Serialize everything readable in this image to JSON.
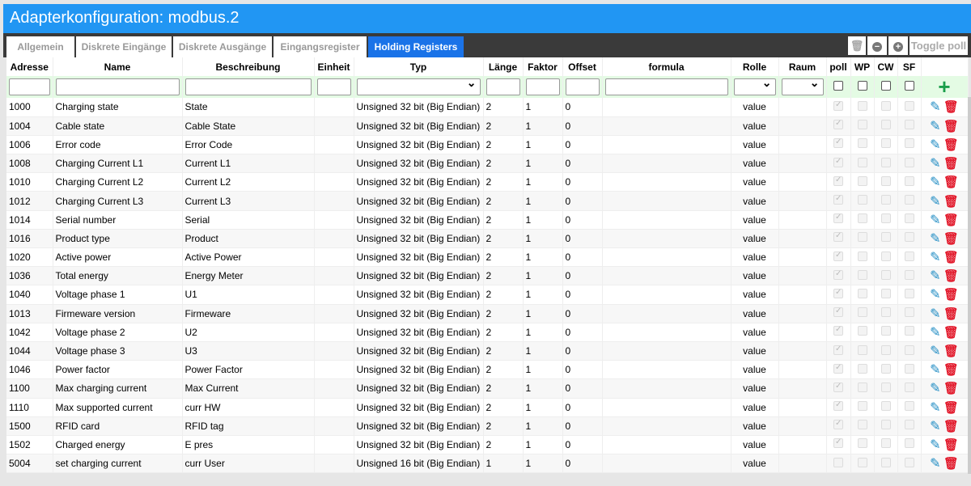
{
  "title": "Adapterkonfiguration: modbus.2",
  "tabs": [
    "Allgemein",
    "Diskrete Eingänge",
    "Diskrete Ausgänge",
    "Eingangsregister",
    "Holding Registers"
  ],
  "toolbar": {
    "toggle_poll": "Toggle poll",
    "minus": "−",
    "plus": "+",
    "delete_icon": "trash-icon"
  },
  "columns": [
    "Adresse",
    "Name",
    "Beschreibung",
    "Einheit",
    "Typ",
    "Länge",
    "Faktor",
    "Offset",
    "formula",
    "Rolle",
    "Raum",
    "poll",
    "WP",
    "CW",
    "SF"
  ],
  "add_icon": "+",
  "rows": [
    {
      "addr": "1000",
      "name": "Charging state",
      "desc": "State",
      "type": "Unsigned 32 bit (Big Endian)",
      "len": "2",
      "factor": "1",
      "offset": "0",
      "role": "value",
      "poll": true
    },
    {
      "addr": "1004",
      "name": "Cable state",
      "desc": "Cable State",
      "type": "Unsigned 32 bit (Big Endian)",
      "len": "2",
      "factor": "1",
      "offset": "0",
      "role": "value",
      "poll": true
    },
    {
      "addr": "1006",
      "name": "Error code",
      "desc": "Error Code",
      "type": "Unsigned 32 bit (Big Endian)",
      "len": "2",
      "factor": "1",
      "offset": "0",
      "role": "value",
      "poll": true
    },
    {
      "addr": "1008",
      "name": "Charging Current L1",
      "desc": "Current L1",
      "type": "Unsigned 32 bit (Big Endian)",
      "len": "2",
      "factor": "1",
      "offset": "0",
      "role": "value",
      "poll": true
    },
    {
      "addr": "1010",
      "name": "Charging Current L2",
      "desc": "Current L2",
      "type": "Unsigned 32 bit (Big Endian)",
      "len": "2",
      "factor": "1",
      "offset": "0",
      "role": "value",
      "poll": true
    },
    {
      "addr": "1012",
      "name": "Charging Current L3",
      "desc": "Current L3",
      "type": "Unsigned 32 bit (Big Endian)",
      "len": "2",
      "factor": "1",
      "offset": "0",
      "role": "value",
      "poll": true
    },
    {
      "addr": "1014",
      "name": "Serial number",
      "desc": "Serial",
      "type": "Unsigned 32 bit (Big Endian)",
      "len": "2",
      "factor": "1",
      "offset": "0",
      "role": "value",
      "poll": true
    },
    {
      "addr": "1016",
      "name": "Product type",
      "desc": "Product",
      "type": "Unsigned 32 bit (Big Endian)",
      "len": "2",
      "factor": "1",
      "offset": "0",
      "role": "value",
      "poll": true
    },
    {
      "addr": "1020",
      "name": "Active power",
      "desc": "Active Power",
      "type": "Unsigned 32 bit (Big Endian)",
      "len": "2",
      "factor": "1",
      "offset": "0",
      "role": "value",
      "poll": true
    },
    {
      "addr": "1036",
      "name": "Total energy",
      "desc": "Energy Meter",
      "type": "Unsigned 32 bit (Big Endian)",
      "len": "2",
      "factor": "1",
      "offset": "0",
      "role": "value",
      "poll": true
    },
    {
      "addr": "1040",
      "name": "Voltage phase 1",
      "desc": "U1",
      "type": "Unsigned 32 bit (Big Endian)",
      "len": "2",
      "factor": "1",
      "offset": "0",
      "role": "value",
      "poll": true
    },
    {
      "addr": "1013",
      "name": "Firmeware version",
      "desc": "Firmeware",
      "type": "Unsigned 32 bit (Big Endian)",
      "len": "2",
      "factor": "1",
      "offset": "0",
      "role": "value",
      "poll": true
    },
    {
      "addr": "1042",
      "name": "Voltage phase 2",
      "desc": "U2",
      "type": "Unsigned 32 bit (Big Endian)",
      "len": "2",
      "factor": "1",
      "offset": "0",
      "role": "value",
      "poll": true
    },
    {
      "addr": "1044",
      "name": "Voltage phase 3",
      "desc": "U3",
      "type": "Unsigned 32 bit (Big Endian)",
      "len": "2",
      "factor": "1",
      "offset": "0",
      "role": "value",
      "poll": true
    },
    {
      "addr": "1046",
      "name": "Power factor",
      "desc": "Power Factor",
      "type": "Unsigned 32 bit (Big Endian)",
      "len": "2",
      "factor": "1",
      "offset": "0",
      "role": "value",
      "poll": true
    },
    {
      "addr": "1100",
      "name": "Max charging current",
      "desc": "Max Current",
      "type": "Unsigned 32 bit (Big Endian)",
      "len": "2",
      "factor": "1",
      "offset": "0",
      "role": "value",
      "poll": true
    },
    {
      "addr": "1110",
      "name": "Max supported current",
      "desc": "curr HW",
      "type": "Unsigned 32 bit (Big Endian)",
      "len": "2",
      "factor": "1",
      "offset": "0",
      "role": "value",
      "poll": true
    },
    {
      "addr": "1500",
      "name": "RFID card",
      "desc": "RFID tag",
      "type": "Unsigned 32 bit (Big Endian)",
      "len": "2",
      "factor": "1",
      "offset": "0",
      "role": "value",
      "poll": true
    },
    {
      "addr": "1502",
      "name": "Charged energy",
      "desc": "E pres",
      "type": "Unsigned 32 bit (Big Endian)",
      "len": "2",
      "factor": "1",
      "offset": "0",
      "role": "value",
      "poll": true
    },
    {
      "addr": "5004",
      "name": "set charging current",
      "desc": "curr User",
      "type": "Unsigned 16 bit (Big Endian)",
      "len": "1",
      "factor": "1",
      "offset": "0",
      "role": "value",
      "poll": false
    }
  ]
}
